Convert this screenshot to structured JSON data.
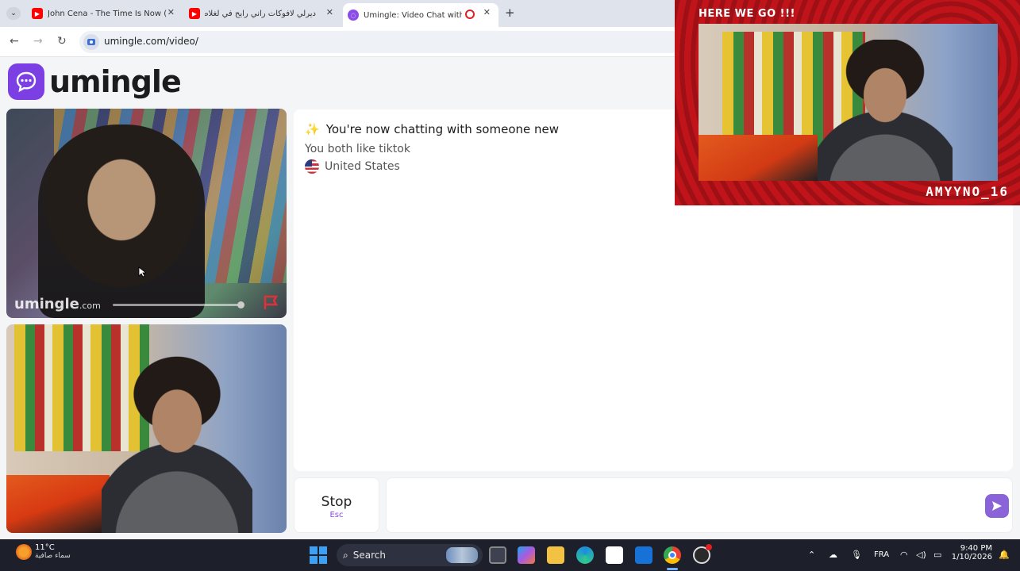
{
  "browser": {
    "tabs": [
      {
        "title": "John Cena - The Time Is Now (E",
        "icon": "youtube-icon",
        "active": false
      },
      {
        "title": "ديرلي لافوكات راني رايح في لغلاط",
        "icon": "youtube-icon",
        "active": false
      },
      {
        "title": "Umingle: Video Chat with S",
        "icon": "umingle-icon",
        "active": true
      }
    ],
    "new_tab": "+",
    "url": "umingle.com/video/"
  },
  "site": {
    "logo_text": "umingle",
    "brand_color": "#7b3fe4",
    "stranger_watermark": "umingle",
    "stranger_watermark_suffix": ".com"
  },
  "chat": {
    "sparkle": "✨",
    "headline": "You're now chatting with someone new",
    "interest": "You both like tiktok",
    "flag": "🇺🇸",
    "country": "United States"
  },
  "controls": {
    "stop_label": "Stop",
    "stop_shortcut": "Esc",
    "message_placeholder": ""
  },
  "stream_overlay": {
    "title": "HERE WE GO !!!",
    "username": "AMYYNO_16"
  },
  "taskbar": {
    "weather_temp": "11°C",
    "weather_desc": "سماء صافية",
    "search_label": "Search",
    "language": "FRA",
    "time": "9:40 PM",
    "date": "1/10/2026"
  }
}
